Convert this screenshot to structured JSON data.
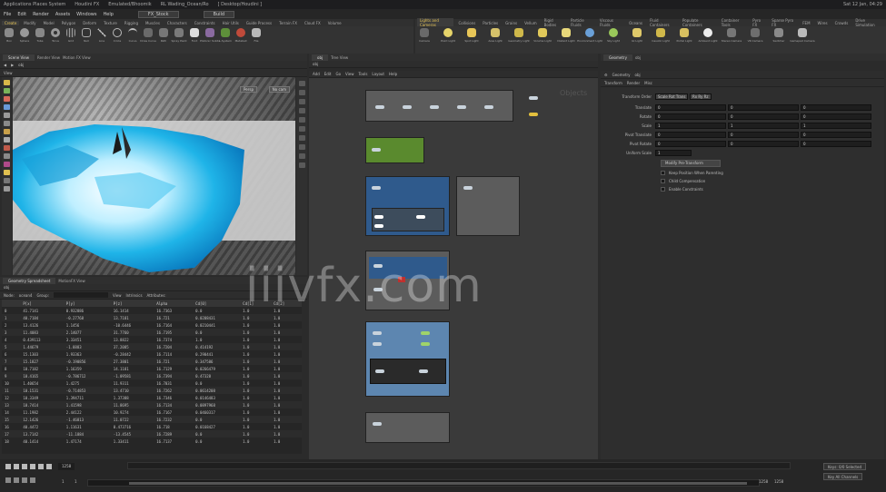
{
  "os_bar": {
    "apps": "Applications  Places  System",
    "item1": "Houdini FX",
    "item2": "Emulated/Bhoomik",
    "item3": "RL Wading_Ocean/Ro",
    "item4": "[ Desktop/Houdini ]",
    "time": "Sat 12 Jan, 04:29"
  },
  "menubar": {
    "items": [
      "File",
      "Edit",
      "Render",
      "Assets",
      "Windows",
      "Help"
    ],
    "desktop": "FX_Stock",
    "build": "Build"
  },
  "shelf_left": {
    "tabs": [
      "Create",
      "Modify",
      "Model",
      "Polygon",
      "Deform",
      "Texture",
      "Rigging",
      "Muscles",
      "Characters",
      "Constraints",
      "Hair Utils",
      "Guide Process",
      "Terrain FX",
      "Cloud FX",
      "Volume"
    ],
    "tools": [
      "Box",
      "Sphere",
      "Tube",
      "Torus",
      "Grid",
      "Null",
      "Line",
      "Circle",
      "Curve",
      "Draw Curve",
      "Path",
      "Spray Paint",
      "Font",
      "Platonic Solids",
      "L-System",
      "Metaball",
      "File"
    ]
  },
  "shelf_right": {
    "tabs": [
      "Lights and Cameras",
      "Collisions",
      "Particles",
      "Grains",
      "Vellum",
      "Rigid Bodies",
      "Particle Fluids",
      "Viscous Fluids",
      "Oceans",
      "Fluid Containers",
      "Populate Containers",
      "Container Tools",
      "Pyro FX",
      "Sparse Pyro FX",
      "FEM",
      "Wires",
      "Crowds",
      "Drive Simulation"
    ],
    "tools": [
      "Camera",
      "Point Light",
      "Spot Light",
      "Area Light",
      "Geometry Light",
      "Volume Light",
      "Distant Light",
      "Environment Light",
      "Sky Light",
      "GI Light",
      "Caustic Light",
      "Portal Light",
      "Ambient Light",
      "Stereo Camera",
      "VR Camera",
      "Switcher",
      "Gamepad Camera"
    ]
  },
  "viewport": {
    "tabs": [
      "Scene View",
      "Render View",
      "Motion FX View"
    ],
    "path": "obj",
    "view_label": "View",
    "persp": "Persp",
    "cam": "No cam"
  },
  "spreadsheet": {
    "tabs": [
      "Geometry Spreadsheet",
      "MotionFX View"
    ],
    "path": "obj",
    "node_label": "Node:",
    "node_value": "ocean4",
    "group_label": "Group:",
    "view_label": "View",
    "intrinsics_label": "Intrinsics",
    "attributes_label": "Attributes:",
    "columns": [
      "",
      "P[x]",
      "P[y]",
      "P[z]",
      "Alpha",
      "Cd[0]",
      "Cd[1]",
      "Cd[2]"
    ],
    "rows": [
      [
        "0",
        "41.7141",
        "0.932886",
        "16.1414",
        "16.7363",
        "0.0",
        "1.0",
        "1.0"
      ],
      [
        "1",
        "40.7184",
        "-0.27768",
        "13.7181",
        "16.721",
        "0.0208431",
        "1.0",
        "1.0"
      ],
      [
        "2",
        "13.4126",
        "1.1456",
        "-10.6446",
        "16.7164",
        "0.0210441",
        "1.0",
        "1.0"
      ],
      [
        "3",
        "11.4083",
        "2.14077",
        "31.7760",
        "16.7195",
        "0.0",
        "1.0",
        "1.0"
      ],
      [
        "4",
        "0.439113",
        "3.33451",
        "13.8822",
        "16.7374",
        "1.0",
        "1.0",
        "1.0"
      ],
      [
        "5",
        "1.44679",
        "-1.8883",
        "37.2085",
        "16.7204",
        "0.414192",
        "1.0",
        "1.0"
      ],
      [
        "6",
        "15.1303",
        "1.93363",
        "-0.28442",
        "16.7114",
        "0.290441",
        "1.0",
        "1.0"
      ],
      [
        "7",
        "15.1827",
        "-0.190856",
        "27.3801",
        "16.721",
        "0.347586",
        "1.0",
        "1.0"
      ],
      [
        "8",
        "10.7182",
        "1.16359",
        "14.1181",
        "16.7129",
        "0.0266479",
        "1.0",
        "1.0"
      ],
      [
        "9",
        "10.4165",
        "-0.786712",
        "-1.09581",
        "16.7394",
        "0.47328",
        "1.0",
        "1.0"
      ],
      [
        "10",
        "1.40654",
        "1.4275",
        "11.9311",
        "16.7031",
        "0.0",
        "1.0",
        "1.0"
      ],
      [
        "11",
        "10.1531",
        "-0.714853",
        "13.4710",
        "16.7262",
        "0.0614208",
        "1.0",
        "1.0"
      ],
      [
        "12",
        "10.3349",
        "1.394711",
        "1.37388",
        "16.7346",
        "0.0146483",
        "1.0",
        "1.0"
      ],
      [
        "13",
        "10.7414",
        "1.41598",
        "11.8695",
        "16.7134",
        "0.0897968",
        "1.0",
        "1.0"
      ],
      [
        "14",
        "11.1982",
        "2.44122",
        "10.9274",
        "16.7167",
        "0.0460317",
        "1.0",
        "1.0"
      ],
      [
        "15",
        "12.1426",
        "-1.46813",
        "11.0722",
        "16.7232",
        "0.0",
        "1.0",
        "1.0"
      ],
      [
        "16",
        "40.4472",
        "1.11631",
        "0.473716",
        "16.718",
        "0.0168427",
        "1.0",
        "1.0"
      ],
      [
        "17",
        "13.7142",
        "-11.1884",
        "-13.4545",
        "16.7289",
        "0.0",
        "1.0",
        "1.0"
      ],
      [
        "18",
        "40.1414",
        "1.47174",
        "1.33411",
        "16.7137",
        "0.0",
        "1.0",
        "1.0"
      ]
    ]
  },
  "network": {
    "tabs": [
      "obj",
      "Tree View"
    ],
    "path": "obj",
    "menu": [
      "Add",
      "Edit",
      "Go",
      "View",
      "Tools",
      "Layout",
      "Help"
    ],
    "context_label": "Objects",
    "watermark": "iiivfx.com"
  },
  "parameters": {
    "tabs": [
      "Geometry",
      "obj"
    ],
    "node_label": "Geometry",
    "node_name": "obj",
    "subtabs": [
      "Transform",
      "Render",
      "Misc"
    ],
    "transform_order_label": "Transform Order",
    "transform_order_value": "Scale Rot Trans",
    "rotate_order_value": "Rx Ry Rz",
    "rows": [
      {
        "label": "Translate",
        "v": [
          "0",
          "0",
          "0"
        ]
      },
      {
        "label": "Rotate",
        "v": [
          "0",
          "0",
          "0"
        ]
      },
      {
        "label": "Scale",
        "v": [
          "1",
          "1",
          "1"
        ]
      },
      {
        "label": "Pivot Translate",
        "v": [
          "0",
          "0",
          "0"
        ]
      },
      {
        "label": "Pivot Rotate",
        "v": [
          "0",
          "0",
          "0"
        ]
      }
    ],
    "uniform_scale_label": "Uniform Scale",
    "uniform_scale_value": "1",
    "modify_pivot": "Modify Pre-Transform",
    "checks": [
      "Keep Position When Parenting",
      "Child Compensation",
      "Enable Constraints"
    ]
  },
  "timeline": {
    "frame": "1258",
    "start": "1",
    "end": "1258",
    "range_start": "1",
    "range_end": "1258",
    "end_field": "1258",
    "key_label": "Keys",
    "auto_update": "Auto Update",
    "right_btn1": "Keys: 0/0 Selected",
    "right_btn2": "Key All Channels",
    "fps": "Sel. Ch."
  },
  "colors": {
    "accent_yellow": "#e8c657",
    "node_green": "#5a8a2e",
    "node_blue": "#2f5a8c",
    "node_lightblue": "#5d86b0",
    "node_red": "#c0302e",
    "water_cyan": "#1fb4e8"
  }
}
